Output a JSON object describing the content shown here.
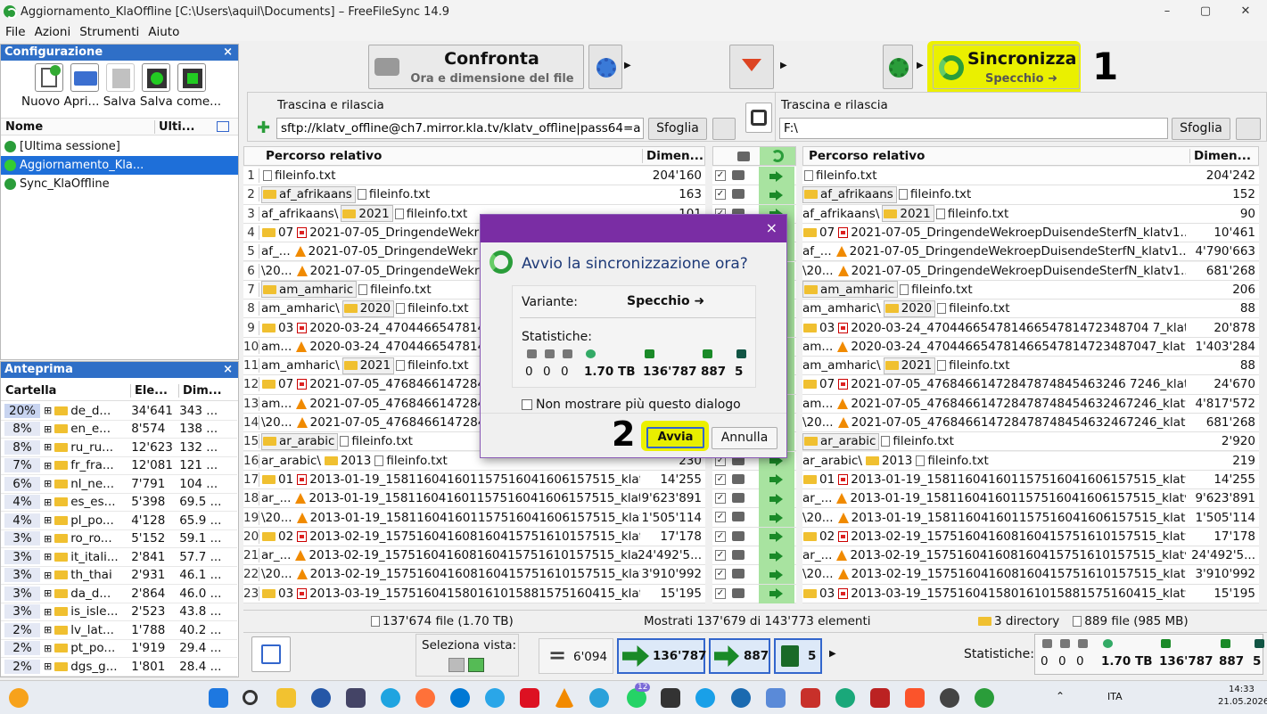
{
  "window": {
    "title": "Aggiornamento_KlaOffline [C:\\Users\\aquil\\Documents] – FreeFileSync 14.9",
    "minimize": "–",
    "maximize": "▢",
    "close": "✕"
  },
  "menu": [
    "File",
    "Azioni",
    "Strumenti",
    "Aiuto"
  ],
  "config_panel": {
    "title": "Configurazione",
    "close": "×",
    "toolbar_labels": "Nuovo Apri... Salva Salva come...",
    "col_name": "Nome",
    "col_last": "Ulti...",
    "items": [
      "[Ultima sessione]",
      "Aggiornamento_Kla...",
      "Sync_KlaOffline"
    ]
  },
  "preview_panel": {
    "title": "Anteprima",
    "close": "×",
    "col_folder": "Cartella",
    "col_elements": "Ele...",
    "col_size": "Dim...",
    "rows": [
      {
        "pct": "20%",
        "name": "de_d...",
        "count": "34'641",
        "size": "343 ..."
      },
      {
        "pct": "8%",
        "name": "en_e...",
        "count": "8'574",
        "size": "138 ..."
      },
      {
        "pct": "8%",
        "name": "ru_ru...",
        "count": "12'623",
        "size": "132 ..."
      },
      {
        "pct": "7%",
        "name": "fr_fra...",
        "count": "12'081",
        "size": "121 ..."
      },
      {
        "pct": "6%",
        "name": "nl_ne...",
        "count": "7'791",
        "size": "104 ..."
      },
      {
        "pct": "4%",
        "name": "es_es...",
        "count": "5'398",
        "size": "69.5 ..."
      },
      {
        "pct": "4%",
        "name": "pl_po...",
        "count": "4'128",
        "size": "65.9 ..."
      },
      {
        "pct": "3%",
        "name": "ro_ro...",
        "count": "5'152",
        "size": "59.1 ..."
      },
      {
        "pct": "3%",
        "name": "it_itali...",
        "count": "2'841",
        "size": "57.7 ..."
      },
      {
        "pct": "3%",
        "name": "th_thai",
        "count": "2'931",
        "size": "46.1 ..."
      },
      {
        "pct": "3%",
        "name": "da_d...",
        "count": "2'864",
        "size": "46.0 ..."
      },
      {
        "pct": "3%",
        "name": "is_isle...",
        "count": "2'523",
        "size": "43.8 ..."
      },
      {
        "pct": "2%",
        "name": "lv_lat...",
        "count": "1'788",
        "size": "40.2 ..."
      },
      {
        "pct": "2%",
        "name": "pt_po...",
        "count": "1'919",
        "size": "29.4 ..."
      },
      {
        "pct": "2%",
        "name": "dgs_g...",
        "count": "1'801",
        "size": "28.4 ..."
      }
    ]
  },
  "top_toolbar": {
    "compare_label": "Confronta",
    "compare_sub": "Ora e dimensione del file",
    "sync_label": "Sincronizza",
    "sync_sub": "Specchio ➜",
    "annotation_1": "1"
  },
  "left_path": {
    "drag_label": "Trascina e rilascia",
    "value": "sftp://klatv_offline@ch7.mirror.kla.tv/klatv_offline|pass64=a",
    "browse": "Sfoglia"
  },
  "right_path": {
    "drag_label": "Trascina e rilascia",
    "value": "F:\\",
    "browse": "Sfoglia"
  },
  "grid": {
    "col_path": "Percorso relativo",
    "col_size": "Dimen...",
    "left_rows": [
      {
        "n": "1",
        "segs": [
          {
            "t": "file",
            "s": "fileinfo.txt"
          }
        ],
        "size": "204'160"
      },
      {
        "n": "2",
        "segs": [
          {
            "t": "folderbox",
            "s": "af_afrikaans"
          },
          {
            "t": "file",
            "s": "fileinfo.txt"
          }
        ],
        "size": "163"
      },
      {
        "n": "3",
        "segs": [
          {
            "t": "plain",
            "s": "af_afrikaans\\"
          },
          {
            "t": "folderbox",
            "s": "2021"
          },
          {
            "t": "file",
            "s": "fileinfo.txt"
          }
        ],
        "size": "101"
      },
      {
        "n": "4",
        "segs": [
          {
            "t": "folder",
            "s": "07"
          },
          {
            "t": "pdf",
            "s": "2021-07-05_DringendeWekr"
          }
        ],
        "size": ""
      },
      {
        "n": "5",
        "segs": [
          {
            "t": "plain",
            "s": "af_..."
          },
          {
            "t": "vlc",
            "s": "2021-07-05_DringendeWekr"
          }
        ],
        "size": ""
      },
      {
        "n": "6",
        "segs": [
          {
            "t": "plain",
            "s": "\\20..."
          },
          {
            "t": "vlc",
            "s": "2021-07-05_DringendeWekr"
          }
        ],
        "size": ""
      },
      {
        "n": "7",
        "segs": [
          {
            "t": "folderbox",
            "s": "am_amharic"
          },
          {
            "t": "file",
            "s": "fileinfo.txt"
          }
        ],
        "size": ""
      },
      {
        "n": "8",
        "segs": [
          {
            "t": "plain",
            "s": "am_amharic\\"
          },
          {
            "t": "folderbox",
            "s": "2020"
          },
          {
            "t": "file",
            "s": "fileinfo.txt"
          }
        ],
        "size": ""
      },
      {
        "n": "9",
        "segs": [
          {
            "t": "folder",
            "s": "03"
          },
          {
            "t": "pdf",
            "s": "2020-03-24_4704466547814"
          }
        ],
        "size": ""
      },
      {
        "n": "10",
        "segs": [
          {
            "t": "plain",
            "s": "am..."
          },
          {
            "t": "vlc",
            "s": "2020-03-24_4704466547814"
          }
        ],
        "size": ""
      },
      {
        "n": "11",
        "segs": [
          {
            "t": "plain",
            "s": "am_amharic\\"
          },
          {
            "t": "folderbox",
            "s": "2021"
          },
          {
            "t": "file",
            "s": "fileinfo.txt"
          }
        ],
        "size": ""
      },
      {
        "n": "12",
        "segs": [
          {
            "t": "folder",
            "s": "07"
          },
          {
            "t": "pdf",
            "s": "2021-07-05_4768466147284"
          }
        ],
        "size": ""
      },
      {
        "n": "13",
        "segs": [
          {
            "t": "plain",
            "s": "am..."
          },
          {
            "t": "vlc",
            "s": "2021-07-05_4768466147284"
          }
        ],
        "size": ""
      },
      {
        "n": "14",
        "segs": [
          {
            "t": "plain",
            "s": "\\20..."
          },
          {
            "t": "vlc",
            "s": "2021-07-05_4768466147284"
          }
        ],
        "size": ""
      },
      {
        "n": "15",
        "segs": [
          {
            "t": "folderbox",
            "s": "ar_arabic"
          },
          {
            "t": "file",
            "s": "fileinfo.txt"
          }
        ],
        "size": ""
      },
      {
        "n": "16",
        "segs": [
          {
            "t": "plain",
            "s": "ar_arabic\\"
          },
          {
            "t": "folder",
            "s": "2013"
          },
          {
            "t": "file",
            "s": "fileinfo.txt"
          }
        ],
        "size": "230"
      },
      {
        "n": "17",
        "segs": [
          {
            "t": "folder",
            "s": "01"
          },
          {
            "t": "pdf",
            "s": "2013-01-19_158116041601157516041606157515_klatv..."
          }
        ],
        "size": "14'255"
      },
      {
        "n": "18",
        "segs": [
          {
            "t": "plain",
            "s": "ar_..."
          },
          {
            "t": "vlc",
            "s": "2013-01-19_158116041601157516041606157515_klatv..."
          }
        ],
        "size": "9'623'891"
      },
      {
        "n": "19",
        "segs": [
          {
            "t": "plain",
            "s": "\\20..."
          },
          {
            "t": "vlc",
            "s": "2013-01-19_158116041601157516041606157515_klatv..."
          }
        ],
        "size": "1'505'114"
      },
      {
        "n": "20",
        "segs": [
          {
            "t": "folder",
            "s": "02"
          },
          {
            "t": "pdf",
            "s": "2013-02-19_157516041608160415751610157515_klatv..."
          }
        ],
        "size": "17'178"
      },
      {
        "n": "21",
        "segs": [
          {
            "t": "plain",
            "s": "ar_..."
          },
          {
            "t": "vlc",
            "s": "2013-02-19_157516041608160415751610157515_klatv..."
          }
        ],
        "size": "24'492'5..."
      },
      {
        "n": "22",
        "segs": [
          {
            "t": "plain",
            "s": "\\20..."
          },
          {
            "t": "vlc",
            "s": "2013-02-19_157516041608160415751610157515_klatv..."
          }
        ],
        "size": "3'910'992"
      },
      {
        "n": "23",
        "segs": [
          {
            "t": "folder",
            "s": "03"
          },
          {
            "t": "pdf",
            "s": "2013-03-19_157516041580161015881575160415_klatv..."
          }
        ],
        "size": "15'195"
      }
    ],
    "right_rows": [
      {
        "segs": [
          {
            "t": "file",
            "s": "fileinfo.txt"
          }
        ],
        "size": "204'242"
      },
      {
        "segs": [
          {
            "t": "folderbox",
            "s": "af_afrikaans"
          },
          {
            "t": "file",
            "s": "fileinfo.txt"
          }
        ],
        "size": "152"
      },
      {
        "segs": [
          {
            "t": "plain",
            "s": "af_afrikaans\\"
          },
          {
            "t": "folderbox",
            "s": "2021"
          },
          {
            "t": "file",
            "s": "fileinfo.txt"
          }
        ],
        "size": "90"
      },
      {
        "segs": [
          {
            "t": "folder",
            "s": "07"
          },
          {
            "t": "pdf",
            "s": "2021-07-05_DringendeWekroepDuisendeSterfN_klatv1..."
          }
        ],
        "size": "10'461"
      },
      {
        "segs": [
          {
            "t": "plain",
            "s": "af_..."
          },
          {
            "t": "vlc",
            "s": "2021-07-05_DringendeWekroepDuisendeSterfN_klatv1..."
          }
        ],
        "size": "4'790'663"
      },
      {
        "segs": [
          {
            "t": "plain",
            "s": "\\20..."
          },
          {
            "t": "vlc",
            "s": "2021-07-05_DringendeWekroepDuisendeSterfN_klatv1..."
          }
        ],
        "size": "681'268"
      },
      {
        "segs": [
          {
            "t": "folderbox",
            "s": "am_amharic"
          },
          {
            "t": "file",
            "s": "fileinfo.txt"
          }
        ],
        "size": "206"
      },
      {
        "segs": [
          {
            "t": "plain",
            "s": "am_amharic\\"
          },
          {
            "t": "folderbox",
            "s": "2020"
          },
          {
            "t": "file",
            "s": "fileinfo.txt"
          }
        ],
        "size": "88"
      },
      {
        "segs": [
          {
            "t": "folder",
            "s": "03"
          },
          {
            "t": "pdf",
            "s": "2020-03-24_47044665478146654781472348704 7_klatv..."
          }
        ],
        "size": "20'878"
      },
      {
        "segs": [
          {
            "t": "plain",
            "s": "am..."
          },
          {
            "t": "vlc",
            "s": "2020-03-24_470446654781466547814723487047_klatv..."
          }
        ],
        "size": "1'403'284"
      },
      {
        "segs": [
          {
            "t": "plain",
            "s": "am_amharic\\"
          },
          {
            "t": "folderbox",
            "s": "2021"
          },
          {
            "t": "file",
            "s": "fileinfo.txt"
          }
        ],
        "size": "88"
      },
      {
        "segs": [
          {
            "t": "folder",
            "s": "07"
          },
          {
            "t": "pdf",
            "s": "2021-07-05_47684661472847874845463246 7246_klatv..."
          }
        ],
        "size": "24'670"
      },
      {
        "segs": [
          {
            "t": "plain",
            "s": "am..."
          },
          {
            "t": "vlc",
            "s": "2021-07-05_476846614728478748454632467246_klatv..."
          }
        ],
        "size": "4'817'572"
      },
      {
        "segs": [
          {
            "t": "plain",
            "s": "\\20..."
          },
          {
            "t": "vlc",
            "s": "2021-07-05_476846614728478748454632467246_klatv..."
          }
        ],
        "size": "681'268"
      },
      {
        "segs": [
          {
            "t": "folderbox",
            "s": "ar_arabic"
          },
          {
            "t": "file",
            "s": "fileinfo.txt"
          }
        ],
        "size": "2'920"
      },
      {
        "segs": [
          {
            "t": "plain",
            "s": "ar_arabic\\"
          },
          {
            "t": "folder",
            "s": "2013"
          },
          {
            "t": "file",
            "s": "fileinfo.txt"
          }
        ],
        "size": "219"
      },
      {
        "segs": [
          {
            "t": "folder",
            "s": "01"
          },
          {
            "t": "pdf",
            "s": "2013-01-19_158116041601157516041606157515_klatv..."
          }
        ],
        "size": "14'255"
      },
      {
        "segs": [
          {
            "t": "plain",
            "s": "ar_..."
          },
          {
            "t": "vlc",
            "s": "2013-01-19_158116041601157516041606157515_klatv..."
          }
        ],
        "size": "9'623'891"
      },
      {
        "segs": [
          {
            "t": "plain",
            "s": "\\20..."
          },
          {
            "t": "vlc",
            "s": "2013-01-19_158116041601157516041606157515_klatv..."
          }
        ],
        "size": "1'505'114"
      },
      {
        "segs": [
          {
            "t": "folder",
            "s": "02"
          },
          {
            "t": "pdf",
            "s": "2013-02-19_157516041608160415751610157515_klatv..."
          }
        ],
        "size": "17'178"
      },
      {
        "segs": [
          {
            "t": "plain",
            "s": "ar_..."
          },
          {
            "t": "vlc",
            "s": "2013-02-19_157516041608160415751610157515_klatv..."
          }
        ],
        "size": "24'492'5..."
      },
      {
        "segs": [
          {
            "t": "plain",
            "s": "\\20..."
          },
          {
            "t": "vlc",
            "s": "2013-02-19_157516041608160415751610157515_klatv..."
          }
        ],
        "size": "3'910'992"
      },
      {
        "segs": [
          {
            "t": "folder",
            "s": "03"
          },
          {
            "t": "pdf",
            "s": "2013-03-19_157516041580161015881575160415_klatv..."
          }
        ],
        "size": "15'195"
      }
    ]
  },
  "status": {
    "left": "137'674 file (1.70 TB)",
    "middle": "Mostrati 137'679 di 143'773 elementi",
    "right_dirs": "3 directory",
    "right_files": "889 file (985 MB)"
  },
  "bottom_bar": {
    "select_view": "Seleziona vista:",
    "equal": "6'094",
    "create": "136'787",
    "update": "887",
    "delete": "5",
    "stats_label": "Statistiche:",
    "stats": [
      "0",
      "0",
      "0",
      "1.70 TB",
      "136'787",
      "887",
      "5"
    ]
  },
  "dialog": {
    "close": "×",
    "title": "Avvio la sincronizzazione ora?",
    "variant_label": "Variante:",
    "variant_value": "Specchio ➜",
    "stats_label": "Statistiche:",
    "stats": [
      "0",
      "0",
      "0",
      "1.70 TB",
      "136'787",
      "887",
      "5"
    ],
    "dont_show": "Non mostrare più questo dialogo",
    "start": "Avvia",
    "cancel": "Annulla",
    "annotation_2": "2"
  },
  "taskbar": {
    "tray_lang": "ITA",
    "time": "14:33",
    "date": "21.05.2026",
    "badge": "12"
  }
}
